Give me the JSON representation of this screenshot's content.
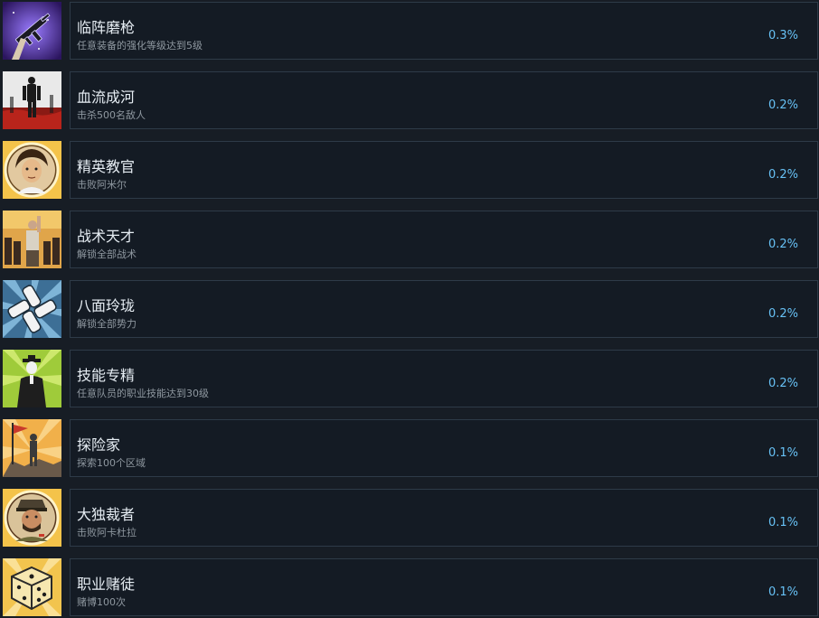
{
  "achievements": [
    {
      "name": "临阵磨枪",
      "desc": "任意装备的强化等级达到5级",
      "percent": "0.3%",
      "icon": "purple-rifle-icon"
    },
    {
      "name": "血流成河",
      "desc": "击杀500名敌人",
      "percent": "0.2%",
      "icon": "blood-river-icon"
    },
    {
      "name": "精英教官",
      "desc": "击败阿米尔",
      "percent": "0.2%",
      "icon": "elite-instructor-portrait-icon"
    },
    {
      "name": "战术天才",
      "desc": "解锁全部战术",
      "percent": "0.2%",
      "icon": "tactical-genius-icon"
    },
    {
      "name": "八面玲珑",
      "desc": "解锁全部势力",
      "percent": "0.2%",
      "icon": "joined-hands-icon"
    },
    {
      "name": "技能专精",
      "desc": "任意队员的职业技能达到30级",
      "percent": "0.2%",
      "icon": "graduate-icon"
    },
    {
      "name": "探险家",
      "desc": "探索100个区域",
      "percent": "0.1%",
      "icon": "explorer-flag-icon"
    },
    {
      "name": "大独裁者",
      "desc": "击败阿卡杜拉",
      "percent": "0.1%",
      "icon": "dictator-portrait-icon"
    },
    {
      "name": "职业赌徒",
      "desc": "赌博100次",
      "percent": "0.1%",
      "icon": "dice-icon"
    }
  ],
  "colors": {
    "background": "#171d25",
    "card": "#141b24",
    "card_border": "#2e3b48",
    "title": "#e6edf3",
    "description": "#8f98a0",
    "percent": "#67c1f5"
  }
}
